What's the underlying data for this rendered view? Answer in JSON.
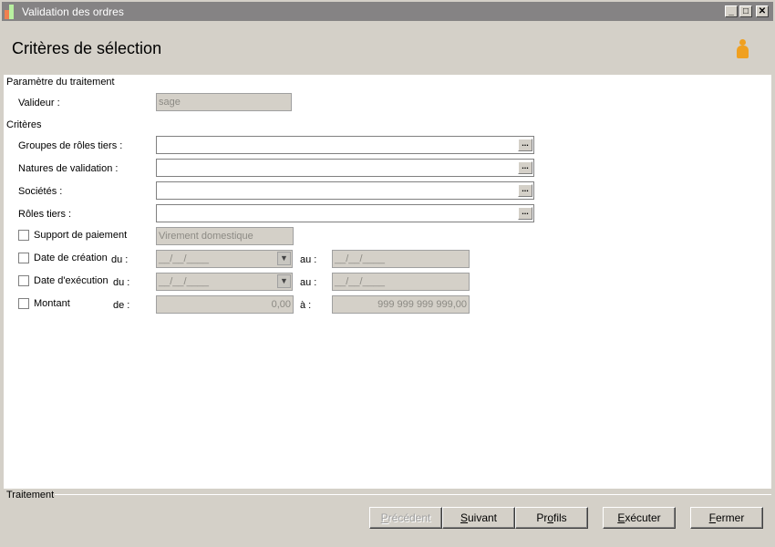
{
  "window": {
    "title": "Validation des ordres"
  },
  "header": {
    "title": "Critères de sélection"
  },
  "sections": {
    "parametre": "Paramètre du traitement",
    "criteres": "Critères",
    "traitement": "Traitement"
  },
  "valideur": {
    "label": "Valideur :",
    "value": "sage"
  },
  "fields": [
    {
      "label": "Groupes de rôles tiers :",
      "value": ""
    },
    {
      "label": "Natures de validation :",
      "value": ""
    },
    {
      "label": "Sociétés :",
      "value": ""
    },
    {
      "label": "Rôles tiers :",
      "value": ""
    }
  ],
  "support": {
    "label": "Support de paiement",
    "value": "Virement domestique"
  },
  "date_creation": {
    "label": "Date de création",
    "du": "du :",
    "from": "__/__/____",
    "au": "au :",
    "to": "__/__/____"
  },
  "date_execution": {
    "label": "Date d'exécution",
    "du": "du :",
    "from": "__/__/____",
    "au": "au :",
    "to": "__/__/____"
  },
  "montant": {
    "label": "Montant",
    "de": "de :",
    "from": "0,00",
    "a": "à :",
    "to": "999 999 999 999,00"
  },
  "buttons": {
    "precedent": {
      "key": "P",
      "rest": "récédent"
    },
    "suivant": {
      "key": "S",
      "rest": "uivant"
    },
    "profils": {
      "pre": "Pr",
      "key": "o",
      "rest": "fils"
    },
    "executer": {
      "key": "E",
      "rest": "xécuter"
    },
    "fermer": {
      "key": "F",
      "rest": "ermer"
    }
  }
}
